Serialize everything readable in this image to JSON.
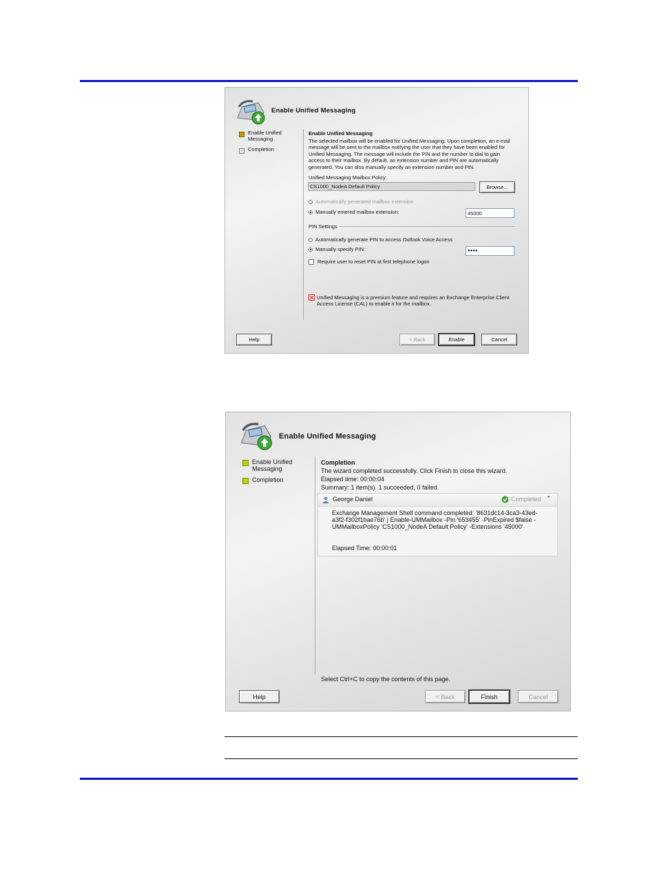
{
  "dialog1": {
    "title": "Enable Unified Messaging",
    "steps": [
      {
        "label": "Enable Unified Messaging",
        "state": "current"
      },
      {
        "label": "Completion",
        "state": "pending"
      }
    ],
    "heading": "Enable Unified Messaging",
    "description": "The selected mailbox will be enabled for Unified Messaging. Upon completion, an e-mail message will be sent to the mailbox notifying the user that they have been enabled for Unified Messaging. The message will include the PIN and the number to dial to gain access to their mailbox. By default, an extension number and PIN are automatically generated. You can also manually specify an extension number and PIN.",
    "policy_label": "Unified Messaging Mailbox Policy:",
    "policy_value": "CS1000_NodeA Default Policy",
    "browse_label": "Browse...",
    "auto_extension_label": "Automatically generated mailbox extension",
    "manual_extension_label": "Manually entered mailbox extension:",
    "extension_value": "45000",
    "pin_settings_label": "PIN Settings",
    "auto_pin_label": "Automatically generate PIN to access Outlook Voice Access",
    "manual_pin_label": "Manually specify PIN:",
    "pin_value": "●●●●",
    "reset_pin_label": "Require user to reset PIN at first telephone logon",
    "premium_note": "Unified Messaging is a premium feature and requires an Exchange Enterprise Client Access License (CAL) to enable it for the mailbox.",
    "buttons": {
      "help": "Help",
      "back": "< Back",
      "enable": "Enable",
      "cancel": "Cancel"
    }
  },
  "dialog2": {
    "title": "Enable Unified Messaging",
    "steps": [
      {
        "label": "Enable Unified Messaging",
        "state": "done"
      },
      {
        "label": "Completion",
        "state": "done"
      }
    ],
    "heading": "Completion",
    "status_line": "The wizard completed successfully. Click Finish to close this wizard.",
    "elapsed": "Elapsed time: 00:00:04",
    "summary": "Summary: 1 item(s). 1 succeeded, 0 failed.",
    "result_name": "George Daniel",
    "result_status": "Completed",
    "command_text": "Exchange Management Shell command completed: '8631dc14-3ca3-43ed-a3f2-f302f1bae76b' | Enable-UMMailbox -Pin '653455' -PinExpired $false -UMMailboxPolicy 'CS1000_NodeA Default Policy' -Extensions '45000'",
    "result_elapsed": "Elapsed Time: 00:00:01",
    "copy_hint": "Select Ctrl+C to copy the contents of this page.",
    "buttons": {
      "help": "Help",
      "back": "< Back",
      "finish": "Finish",
      "cancel": "Cancel"
    }
  },
  "colors": {
    "rule": "#0a10c8",
    "step_done": "#c0d000",
    "step_current": "#c89a00",
    "ok": "#3aa02a",
    "warn": "#d02020"
  },
  "icons": [
    "unified-messaging-phone-icon",
    "success-check-icon",
    "user-icon",
    "collapse-chevron-icon",
    "warning-icon"
  ]
}
